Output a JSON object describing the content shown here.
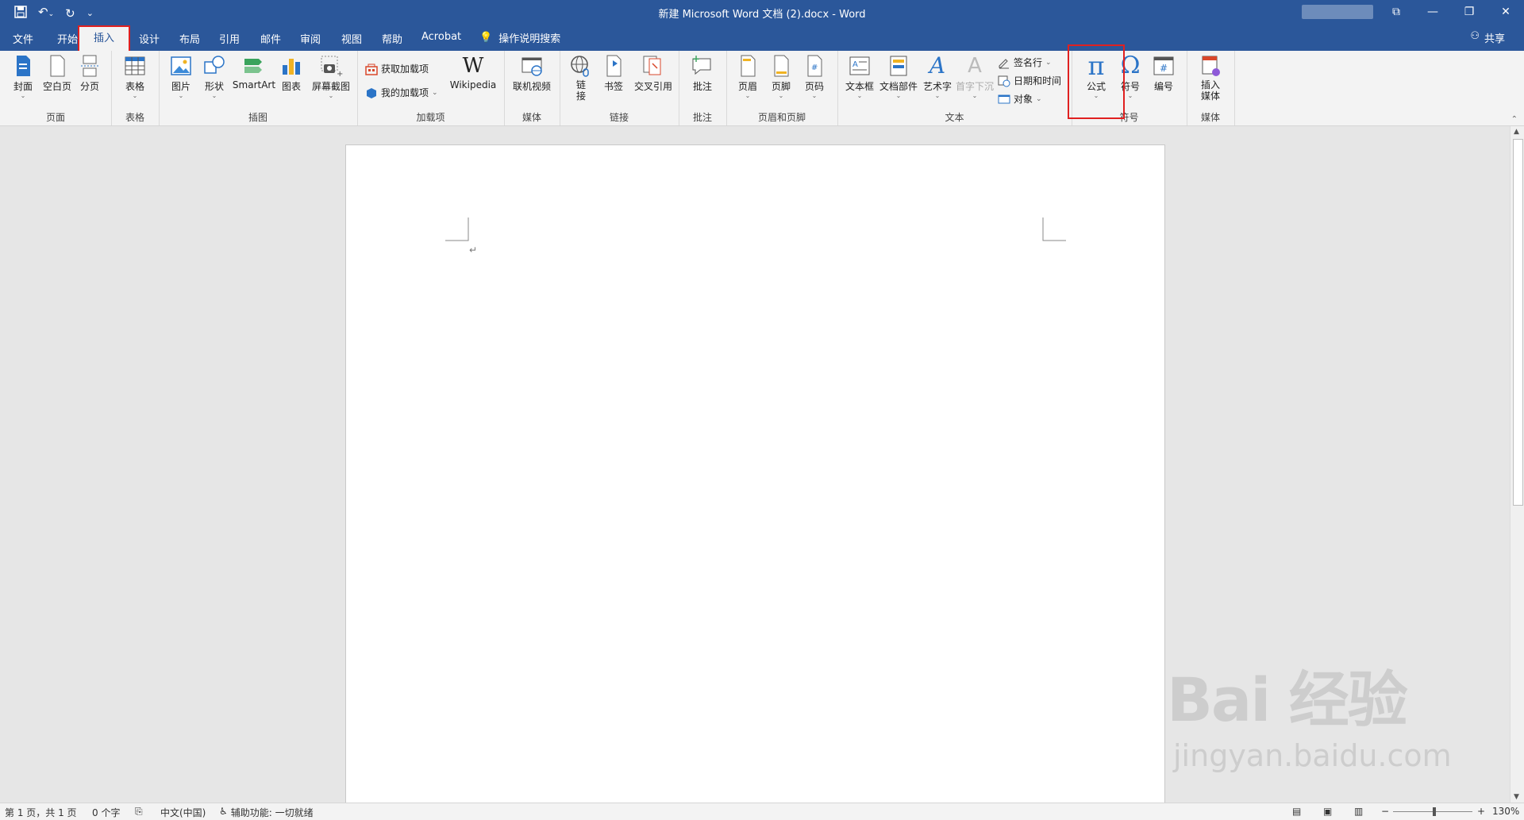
{
  "window": {
    "title": "新建 Microsoft Word 文档 (2).docx  -  Word",
    "qat": {
      "save_icon": "save-icon",
      "undo_icon": "undo-icon",
      "redo_icon": "redo-icon",
      "customize_icon": "customize-qat-icon"
    },
    "controls": {
      "ribbon_display": "ribbon-display-options-icon",
      "minimize": "—",
      "restore": "❐",
      "close": "✕"
    }
  },
  "tabs": [
    {
      "label": "文件"
    },
    {
      "label": "开始"
    },
    {
      "label": "插入",
      "active": true
    },
    {
      "label": "设计"
    },
    {
      "label": "布局"
    },
    {
      "label": "引用"
    },
    {
      "label": "邮件"
    },
    {
      "label": "审阅"
    },
    {
      "label": "视图"
    },
    {
      "label": "帮助"
    },
    {
      "label": "Acrobat"
    }
  ],
  "tell_me": "操作说明搜索",
  "share": "共享",
  "ribbon": {
    "pages": {
      "label": "页面",
      "cover": "封面",
      "blank": "空白页",
      "break": "分页"
    },
    "tables": {
      "label": "表格",
      "table": "表格"
    },
    "illustrations": {
      "label": "插图",
      "picture": "图片",
      "shapes": "形状",
      "smartart": "SmartArt",
      "chart": "图表",
      "screenshot": "屏幕截图"
    },
    "addins": {
      "label": "加载项",
      "get": "获取加载项",
      "my": "我的加载项",
      "wikipedia": "Wikipedia"
    },
    "media1": {
      "label": "媒体",
      "online_video": "联机视频"
    },
    "links": {
      "label": "链接",
      "link": "链\n接",
      "bookmark": "书签",
      "crossref": "交叉引用"
    },
    "comments": {
      "label": "批注",
      "comment": "批注"
    },
    "headerfooter": {
      "label": "页眉和页脚",
      "header": "页眉",
      "footer": "页脚",
      "pagenum": "页码"
    },
    "text": {
      "label": "文本",
      "textbox": "文本框",
      "quickparts": "文档部件",
      "wordart": "艺术字",
      "dropcap": "首字下沉",
      "sigline": "签名行",
      "datetime": "日期和时间",
      "object": "对象"
    },
    "symbols": {
      "label": "符号",
      "equation": "公式",
      "symbol": "符号",
      "number": "编号"
    },
    "media2": {
      "label": "媒体",
      "insert_media": "插入\n媒体"
    }
  },
  "document": {
    "paragraph_mark": "↵"
  },
  "status": {
    "page": "第 1 页，共 1 页",
    "words": "0 个字",
    "language": "中文(中国)",
    "accessibility": "辅助功能: 一切就绪",
    "zoom": "130%",
    "zoom_minus": "−",
    "zoom_plus": "+"
  },
  "watermark": {
    "main": "Bai 经验",
    "sub": "jingyan.baidu.com"
  },
  "colors": {
    "title_bar": "#2b579a",
    "highlight": "#e02020",
    "ribbon_bg": "#f3f3f3"
  }
}
